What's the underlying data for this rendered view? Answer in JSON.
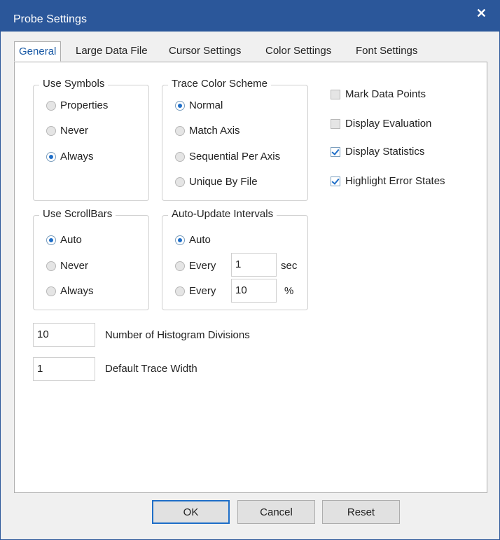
{
  "window": {
    "title": "Probe Settings",
    "close_label": "✕"
  },
  "tabs": [
    {
      "label": "General",
      "active": true
    },
    {
      "label": "Large Data File"
    },
    {
      "label": "Cursor Settings"
    },
    {
      "label": "Color Settings"
    },
    {
      "label": "Font Settings"
    }
  ],
  "use_symbols": {
    "title": "Use Symbols",
    "options": [
      "Properties",
      "Never",
      "Always"
    ],
    "selected": "Always"
  },
  "trace_color_scheme": {
    "title": "Trace Color Scheme",
    "options": [
      "Normal",
      "Match Axis",
      "Sequential Per Axis",
      "Unique By File"
    ],
    "selected": "Normal"
  },
  "checkboxes": [
    {
      "label": "Mark Data Points",
      "checked": false
    },
    {
      "label": "Display Evaluation",
      "checked": false
    },
    {
      "label": "Display Statistics",
      "checked": true
    },
    {
      "label": "Highlight Error States",
      "checked": true
    }
  ],
  "use_scrollbars": {
    "title": "Use ScrollBars",
    "options": [
      "Auto",
      "Never",
      "Always"
    ],
    "selected": "Auto"
  },
  "auto_update": {
    "title": "Auto-Update Intervals",
    "auto_label": "Auto",
    "every_label": "Every",
    "every_sec_value": "1",
    "sec_unit": "sec",
    "every_pct_value": "10",
    "pct_unit": "%",
    "selected": "Auto"
  },
  "histogram": {
    "value": "10",
    "label": "Number of Histogram Divisions"
  },
  "trace_width": {
    "value": "1",
    "label": "Default Trace Width"
  },
  "buttons": {
    "ok": "OK",
    "cancel": "Cancel",
    "reset": "Reset"
  },
  "colors": {
    "accent": "#2b579a",
    "selection": "#1e6ec8"
  }
}
